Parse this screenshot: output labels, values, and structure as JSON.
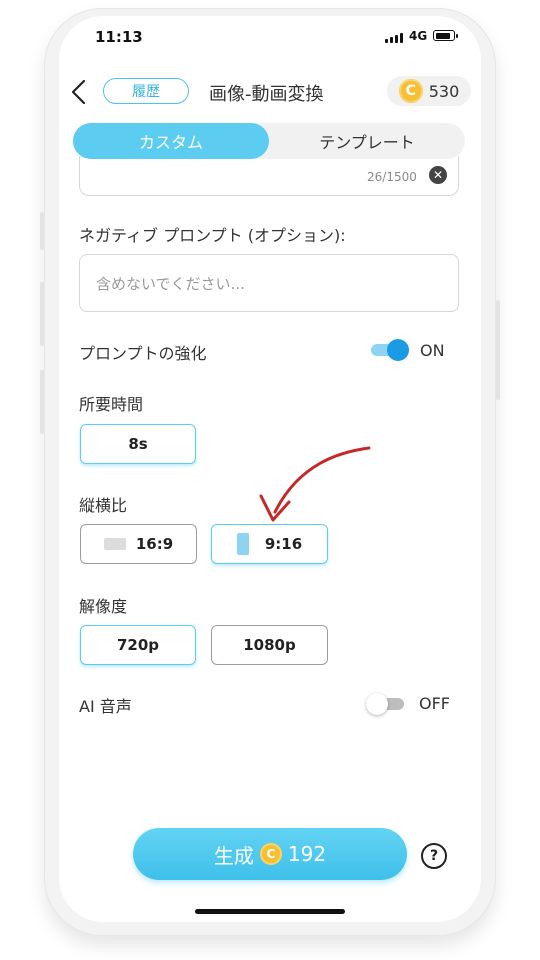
{
  "status_bar": {
    "time": "11:13",
    "network": "4G"
  },
  "header": {
    "history_label": "履歴",
    "title": "画像-動画変換",
    "credits": "530",
    "coin_letter": "C"
  },
  "tabs": [
    {
      "label": "カスタム",
      "active": true
    },
    {
      "label": "テンプレート",
      "active": false
    }
  ],
  "prompt": {
    "char_count": "26/1500"
  },
  "negative_prompt": {
    "label": "ネガティブ プロンプト (オプション):",
    "placeholder": "含めないでください..."
  },
  "enhance": {
    "label": "プロンプトの強化",
    "state": "ON"
  },
  "duration": {
    "label": "所要時間",
    "options": [
      {
        "label": "8s",
        "selected": true
      }
    ]
  },
  "aspect_ratio": {
    "label": "縦横比",
    "options": [
      {
        "label": "16:9",
        "selected": false
      },
      {
        "label": "9:16",
        "selected": true
      }
    ]
  },
  "resolution": {
    "label": "解像度",
    "options": [
      {
        "label": "720p",
        "selected": true
      },
      {
        "label": "1080p",
        "selected": false
      }
    ]
  },
  "ai_voice": {
    "label": "AI 音声",
    "state": "OFF"
  },
  "generate": {
    "label": "生成",
    "cost": "192"
  },
  "colors": {
    "accent": "#5ccdf0",
    "toggle_on": "#1b9be3",
    "coin": "#f7bf33",
    "arrow": "#c62828"
  }
}
